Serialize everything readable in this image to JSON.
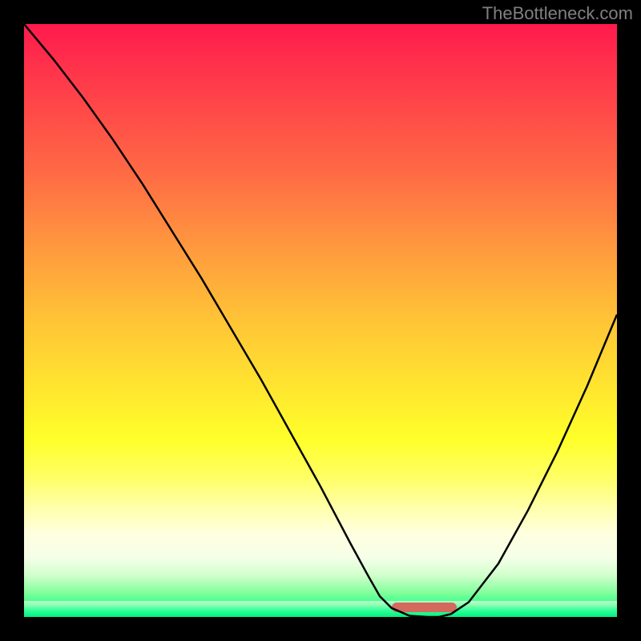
{
  "watermark": "TheBottleneck.com",
  "chart_data": {
    "type": "line",
    "title": "",
    "xlabel": "",
    "ylabel": "",
    "xlim": [
      0,
      100
    ],
    "ylim": [
      0,
      100
    ],
    "series": [
      {
        "name": "bottleneck-curve",
        "x": [
          0,
          5,
          10,
          15,
          20,
          25,
          30,
          35,
          40,
          45,
          50,
          55,
          58,
          60,
          62,
          65,
          68,
          70,
          72,
          75,
          80,
          85,
          90,
          95,
          100
        ],
        "y": [
          100,
          94,
          87.5,
          80.5,
          73,
          65,
          57,
          48.5,
          40,
          31,
          22,
          12.5,
          7,
          3.5,
          1.5,
          0.2,
          0,
          0,
          0.5,
          2.5,
          9,
          18,
          28,
          39,
          51
        ]
      }
    ],
    "optimal_range": {
      "start": 62,
      "end": 73
    },
    "gradient_stops": [
      {
        "pos": 0,
        "color": "#ff1a4d"
      },
      {
        "pos": 25,
        "color": "#ff6a45"
      },
      {
        "pos": 50,
        "color": "#ffc436"
      },
      {
        "pos": 70,
        "color": "#ffff2a"
      },
      {
        "pos": 90,
        "color": "#f5ffe8"
      },
      {
        "pos": 100,
        "color": "#00e878"
      }
    ]
  }
}
